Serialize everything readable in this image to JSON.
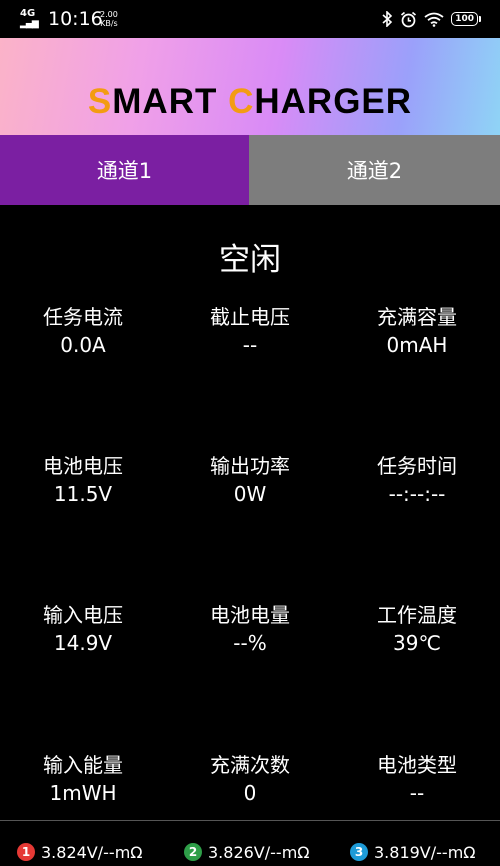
{
  "status_bar": {
    "network": "4G",
    "time": "10:16",
    "speed_value": "2.00",
    "speed_unit": "KB/s",
    "battery": "100"
  },
  "header": {
    "logo_accent_1": "S",
    "logo_part_1": "MART ",
    "logo_accent_2": "C",
    "logo_part_2": "HARGER"
  },
  "tabs": [
    {
      "label": "通道1",
      "active": true
    },
    {
      "label": "通道2",
      "active": false
    }
  ],
  "main": {
    "status": "空闲",
    "metrics": [
      {
        "label": "任务电流",
        "value": "0.0A"
      },
      {
        "label": "截止电压",
        "value": "--"
      },
      {
        "label": "充满容量",
        "value": "0mAH"
      },
      {
        "label": "电池电压",
        "value": "11.5V"
      },
      {
        "label": "输出功率",
        "value": "0W"
      },
      {
        "label": "任务时间",
        "value": "--:--:--"
      },
      {
        "label": "输入电压",
        "value": "14.9V"
      },
      {
        "label": "电池电量",
        "value": "--%"
      },
      {
        "label": "工作温度",
        "value": "39℃"
      },
      {
        "label": "输入能量",
        "value": "1mWH"
      },
      {
        "label": "充满次数",
        "value": "0"
      },
      {
        "label": "电池类型",
        "value": "--"
      }
    ]
  },
  "cells": [
    {
      "index": "1",
      "value": "3.824V/--mΩ",
      "color": "#e53935"
    },
    {
      "index": "2",
      "value": "3.826V/--mΩ",
      "color": "#2e9e48"
    },
    {
      "index": "3",
      "value": "3.819V/--mΩ",
      "color": "#1e9bd7"
    }
  ],
  "colors": {
    "accent_purple": "#7b1fa2",
    "inactive_tab": "#7d7d7d",
    "logo_accent": "#f39c12"
  }
}
